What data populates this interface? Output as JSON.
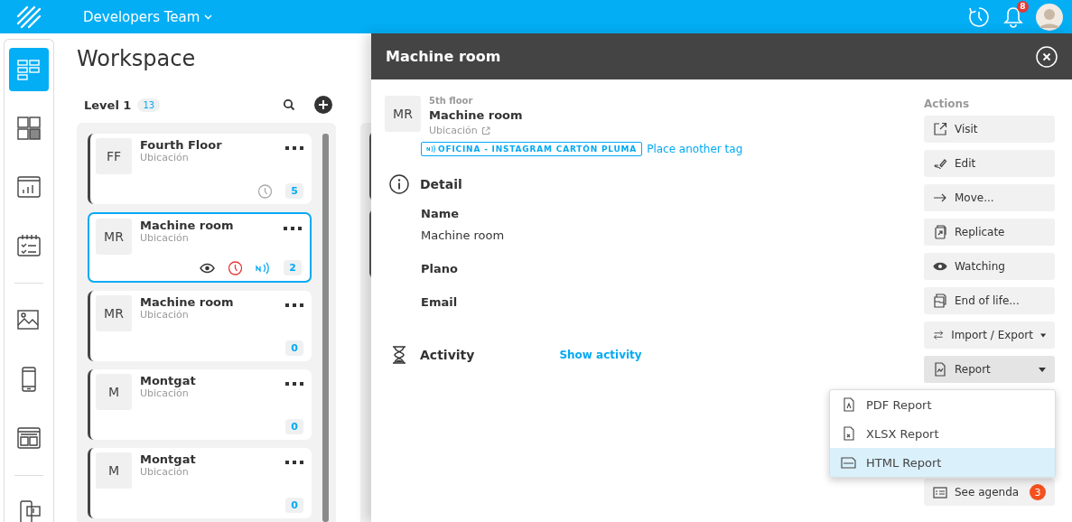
{
  "topbar": {
    "team": "Developers Team",
    "notifications": "8"
  },
  "rail": [
    {
      "kind": "board",
      "selected": true
    },
    {
      "kind": "grid",
      "selected": false
    },
    {
      "kind": "chart",
      "selected": false
    },
    {
      "kind": "calendar",
      "selected": false,
      "divider_after": true
    },
    {
      "kind": "gallery",
      "selected": false
    },
    {
      "kind": "phone",
      "selected": false
    },
    {
      "kind": "layout",
      "selected": false,
      "divider_after": true
    },
    {
      "kind": "phone-alert",
      "selected": false
    }
  ],
  "workspace": {
    "title": "Workspace",
    "columns": [
      {
        "title": "Level 1",
        "count": "13",
        "cards": [
          {
            "initials": "FF",
            "name": "Fourth Floor",
            "type": "Ubicación",
            "selected": false,
            "reminder": true,
            "overdue": false,
            "count": "5"
          },
          {
            "initials": "MR",
            "name": "Machine room",
            "type": "Ubicación",
            "selected": true,
            "watching": true,
            "reminder": true,
            "overdue": true,
            "nfc": true,
            "count": "2"
          },
          {
            "initials": "MR",
            "name": "Machine room",
            "type": "Ubicación",
            "selected": false,
            "count": "0"
          },
          {
            "initials": "M",
            "name": "Montgat",
            "type": "Ubicación",
            "selected": false,
            "count": "0"
          },
          {
            "initials": "M",
            "name": "Montgat",
            "type": "Ubicación",
            "selected": false,
            "count": "0"
          }
        ]
      }
    ]
  },
  "panel": {
    "title": "Machine room",
    "initials": "MR",
    "parent": "5th floor",
    "name": "Machine room",
    "type": "Ubicación",
    "tag": "OFICINA - INSTAGRAM CARTÓN PLUMA",
    "tag_link": "Place another tag",
    "detail": {
      "title": "Detail",
      "fields": [
        {
          "label": "Name",
          "value": "Machine room"
        },
        {
          "label": "Plano"
        },
        {
          "label": "Email"
        }
      ]
    },
    "activity": {
      "title": "Activity",
      "link": "Show activity"
    },
    "actions_title": "Actions",
    "actions": [
      {
        "kind": "visit",
        "label": "Visit"
      },
      {
        "kind": "edit",
        "label": "Edit"
      },
      {
        "kind": "move",
        "label": "Move..."
      },
      {
        "kind": "replicate",
        "label": "Replicate"
      },
      {
        "kind": "watch",
        "label": "Watching"
      },
      {
        "kind": "end",
        "label": "End of life..."
      },
      {
        "kind": "swap",
        "label": "Import / Export",
        "dropdown": true,
        "expanded": false
      },
      {
        "kind": "report",
        "label": "Report",
        "dropdown": true,
        "expanded": true
      },
      {
        "kind": "agenda",
        "label": "See agenda",
        "badge": "3"
      }
    ],
    "menu": [
      {
        "kind": "pdf",
        "label": "PDF Report",
        "selected": false
      },
      {
        "kind": "xlsx",
        "label": "XLSX Report",
        "selected": false
      },
      {
        "kind": "html",
        "label": "HTML Report",
        "selected": true
      }
    ]
  }
}
